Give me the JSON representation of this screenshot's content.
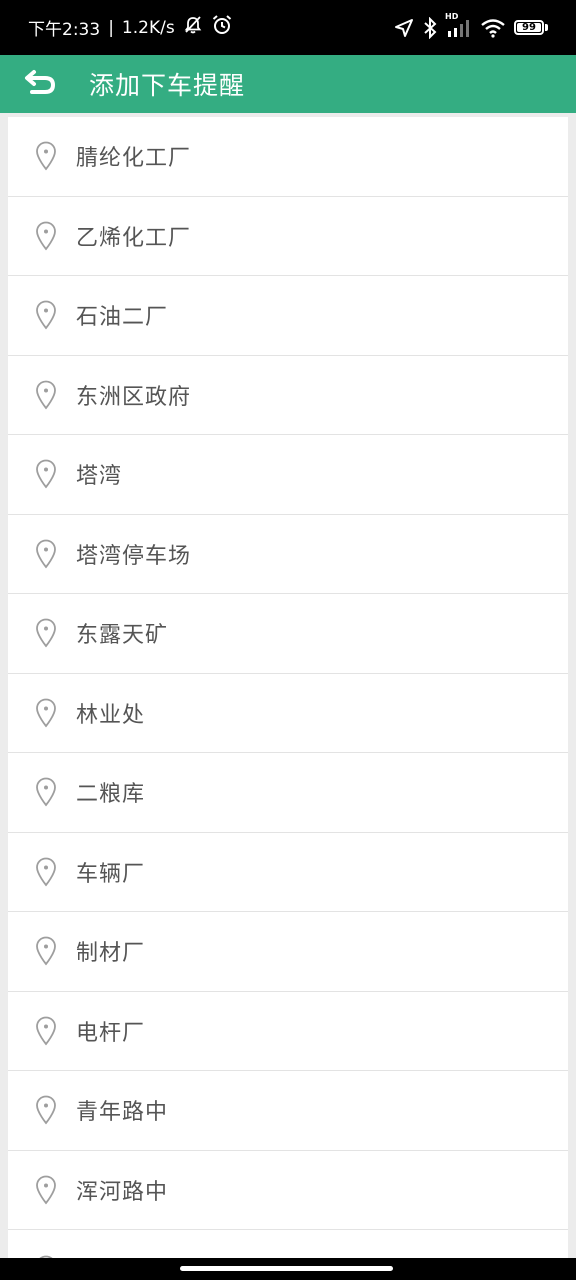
{
  "status_bar": {
    "time": "下午2:33",
    "separator": "|",
    "speed": "1.2K/s",
    "battery": "99",
    "hd_label": "HD"
  },
  "app_bar": {
    "title": "添加下车提醒"
  },
  "stops": [
    "腈纶化工厂",
    "乙烯化工厂",
    "石油二厂",
    "东洲区政府",
    "塔湾",
    "塔湾停车场",
    "东露天矿",
    "林业处",
    "二粮库",
    "车辆厂",
    "制材厂",
    "电杆厂",
    "青年路中",
    "浑河路中"
  ],
  "colors": {
    "accent": "#34ad82",
    "pin": "#9e9e9e",
    "text": "#555555"
  },
  "icons": {
    "back": "back-arrow-icon",
    "pin": "location-pin-icon"
  }
}
